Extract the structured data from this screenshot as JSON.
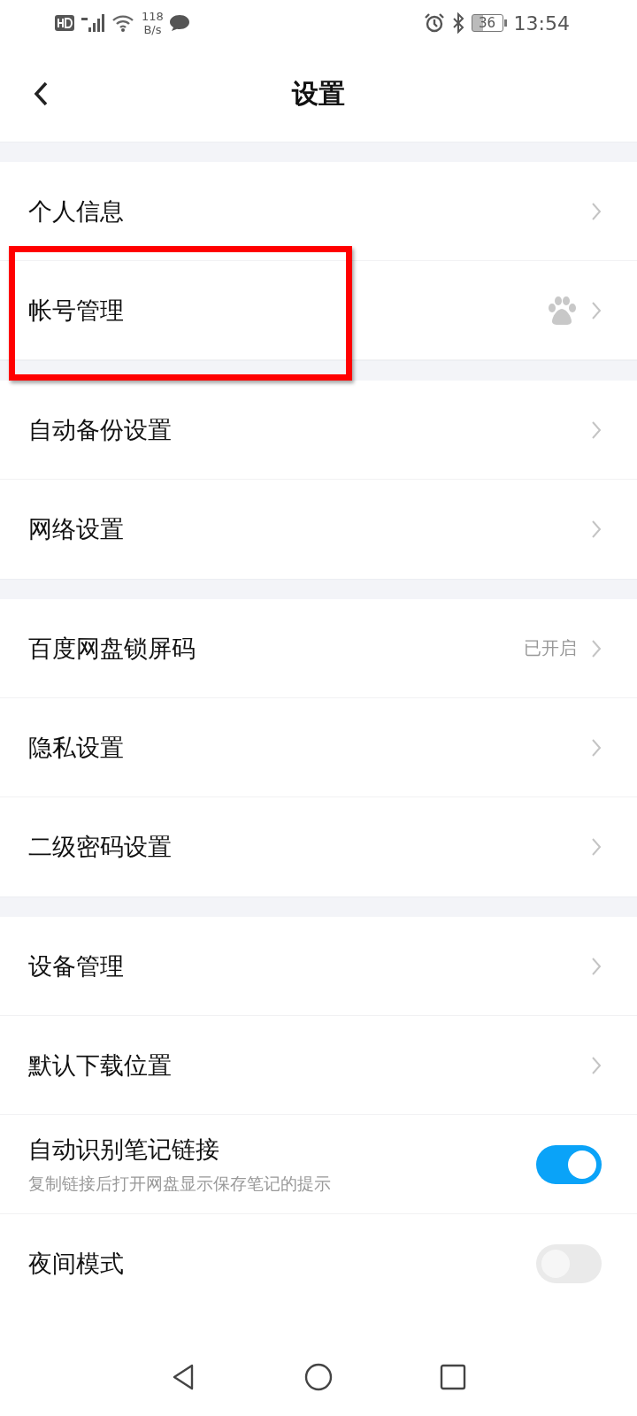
{
  "status_bar": {
    "speed": "118",
    "speed_unit": "B/s",
    "battery": "36",
    "time": "13:54"
  },
  "header": {
    "title": "设置"
  },
  "groups": [
    {
      "items": [
        {
          "kind": "link",
          "label": "个人信息"
        },
        {
          "kind": "link",
          "label": "帐号管理",
          "logo": true,
          "highlighted": true
        }
      ]
    },
    {
      "items": [
        {
          "kind": "link",
          "label": "自动备份设置"
        },
        {
          "kind": "link",
          "label": "网络设置"
        }
      ]
    },
    {
      "items": [
        {
          "kind": "link",
          "label": "百度网盘锁屏码",
          "value": "已开启"
        },
        {
          "kind": "link",
          "label": "隐私设置"
        },
        {
          "kind": "link",
          "label": "二级密码设置"
        }
      ]
    },
    {
      "items": [
        {
          "kind": "link",
          "label": "设备管理"
        },
        {
          "kind": "link",
          "label": "默认下载位置"
        },
        {
          "kind": "toggle",
          "label": "自动识别笔记链接",
          "description": "复制链接后打开网盘显示保存笔记的提示",
          "on": true
        },
        {
          "kind": "toggle",
          "label": "夜间模式",
          "on": false
        }
      ]
    }
  ]
}
